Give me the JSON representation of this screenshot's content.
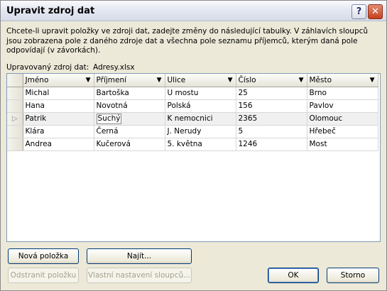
{
  "window": {
    "title": "Upravit zdroj dat",
    "help_glyph": "?",
    "close_glyph": "✕"
  },
  "intro_text": "Chcete-li upravit položky ve zdroji dat, zadejte změny do následující tabulky. V záhlavích sloupců jsou zobrazena pole z daného zdroje dat a všechna pole seznamu příjemců, kterým daná pole odpovídají (v závorkách).",
  "source": {
    "label": "Upravovaný zdroj dat:",
    "value": "Adresy.xlsx"
  },
  "table": {
    "columns": [
      "Jméno",
      "Příjmení",
      "Ulice",
      "Číslo",
      "Město"
    ],
    "rows": [
      [
        "Michal",
        "Bartoška",
        "U mostu",
        "25",
        "Brno"
      ],
      [
        "Hana",
        "Novotná",
        "Polská",
        "156",
        "Pavlov"
      ],
      [
        "Patrik",
        "Suchý",
        "K nemocnici",
        "2365",
        "Olomouc"
      ],
      [
        "Klára",
        "Černá",
        "J. Nerudy",
        "5",
        "Hřebeč"
      ],
      [
        "Andrea",
        "Kučerová",
        "5. května",
        "1246",
        "Most"
      ]
    ],
    "current_row_index": 2,
    "current_marker": "▷"
  },
  "buttons": {
    "new_item": "Nová položka",
    "find": "Najít...",
    "delete_item": "Odstranit položku",
    "custom_columns": "Vlastní nastavení sloupců...",
    "ok": "OK",
    "cancel": "Storno"
  }
}
